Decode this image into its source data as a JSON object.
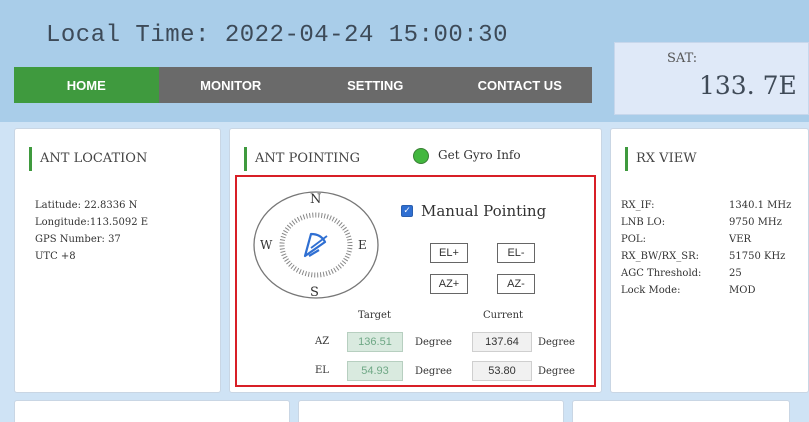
{
  "header": {
    "local_time": "Local Time: 2022-04-24 15:00:30",
    "sat_label": "SAT:",
    "sat_value": "133. 7E"
  },
  "nav": {
    "items": [
      {
        "label": "HOME",
        "active": true
      },
      {
        "label": "MONITOR",
        "active": false
      },
      {
        "label": "SETTING",
        "active": false
      },
      {
        "label": "CONTACT US",
        "active": false
      }
    ]
  },
  "ant_location": {
    "title": "ANT LOCATION",
    "rows": [
      {
        "label": "Latitude: 22.8336 N"
      },
      {
        "label": "Longitude:113.5092 E"
      },
      {
        "label": "GPS Number:  37"
      },
      {
        "label": "UTC    +8"
      }
    ]
  },
  "ant_pointing": {
    "title": "ANT POINTING",
    "gyro_label": "Get Gyro Info",
    "manual_label": "Manual Pointing",
    "manual_checked": true,
    "compass": {
      "n": "N",
      "s": "S",
      "e": "E",
      "w": "W"
    },
    "buttons": {
      "el_plus": "EL+",
      "el_minus": "EL-",
      "az_plus": "AZ+",
      "az_minus": "AZ-"
    },
    "headers": {
      "target": "Target",
      "current": "Current"
    },
    "az": {
      "label": "AZ",
      "target": "136.51",
      "current": "137.64",
      "unit": "Degree"
    },
    "el": {
      "label": "EL",
      "target": "54.93",
      "current": "53.80",
      "unit": "Degree"
    }
  },
  "rx_view": {
    "title": "RX VIEW",
    "rows": [
      {
        "label": "RX_IF:",
        "value": "1340.1 MHz"
      },
      {
        "label": "LNB LO:",
        "value": "9750 MHz"
      },
      {
        "label": "POL:",
        "value": "VER"
      },
      {
        "label": "RX_BW/RX_SR:",
        "value": "51750 KHz"
      },
      {
        "label": "AGC Threshold:",
        "value": "25"
      },
      {
        "label": "Lock Mode:",
        "value": "MOD"
      }
    ]
  },
  "colors": {
    "accent": "#3f9a3e",
    "highlight": "#d81f26",
    "checkbox": "#2f6fd2"
  }
}
